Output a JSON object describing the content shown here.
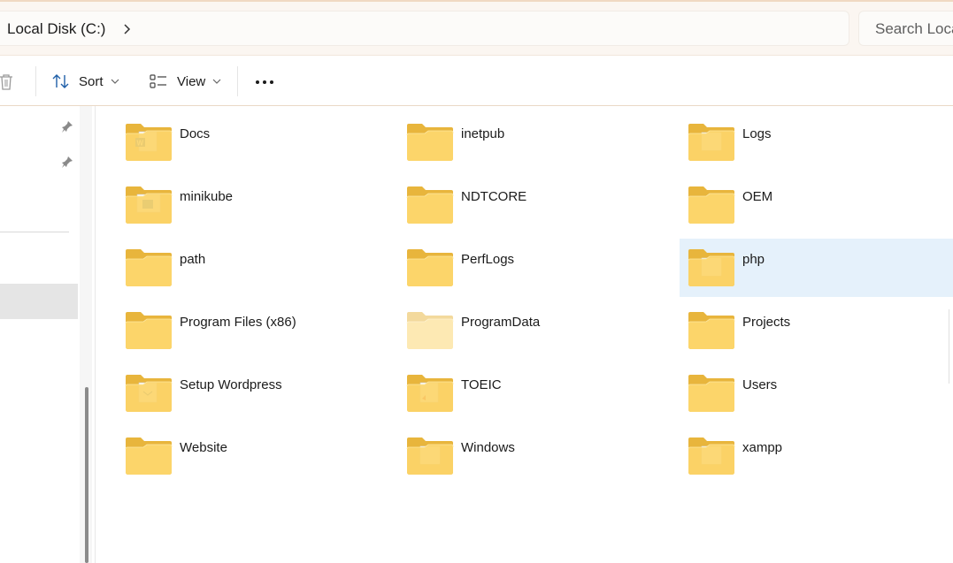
{
  "address_bar": {
    "current_location": "Local Disk (C:)",
    "search_placeholder": "Search Local Disk (C:)"
  },
  "toolbar": {
    "delete_icon": "trash-icon",
    "sort_label": "Sort",
    "view_label": "View",
    "more_icon": "more-ellipsis-icon"
  },
  "sidebar": {
    "pinned_icons": [
      "pin-icon",
      "pin-icon"
    ]
  },
  "folders": [
    {
      "name": "Docs",
      "overlay": "word-doc"
    },
    {
      "name": "inetpub",
      "overlay": "none"
    },
    {
      "name": "Logs",
      "overlay": "paper"
    },
    {
      "name": "minikube",
      "overlay": "blue-doc"
    },
    {
      "name": "NDTCORE",
      "overlay": "none"
    },
    {
      "name": "OEM",
      "overlay": "none"
    },
    {
      "name": "path",
      "overlay": "none"
    },
    {
      "name": "PerfLogs",
      "overlay": "none"
    },
    {
      "name": "php",
      "overlay": "paper",
      "selected": true
    },
    {
      "name": "Program Files (x86)",
      "overlay": "none"
    },
    {
      "name": "ProgramData",
      "overlay": "none",
      "hidden": true
    },
    {
      "name": "Projects",
      "overlay": "none"
    },
    {
      "name": "Setup Wordpress",
      "overlay": "mail-doc"
    },
    {
      "name": "TOEIC",
      "overlay": "red-doc"
    },
    {
      "name": "Users",
      "overlay": "none"
    },
    {
      "name": "Website",
      "overlay": "none"
    },
    {
      "name": "Windows",
      "overlay": "paper"
    },
    {
      "name": "xampp",
      "overlay": "paper"
    }
  ],
  "colors": {
    "folder_back": "#e8b53c",
    "folder_front": "#fcd56a",
    "selection": "#e5f1fb",
    "accent": "#0067c0"
  }
}
